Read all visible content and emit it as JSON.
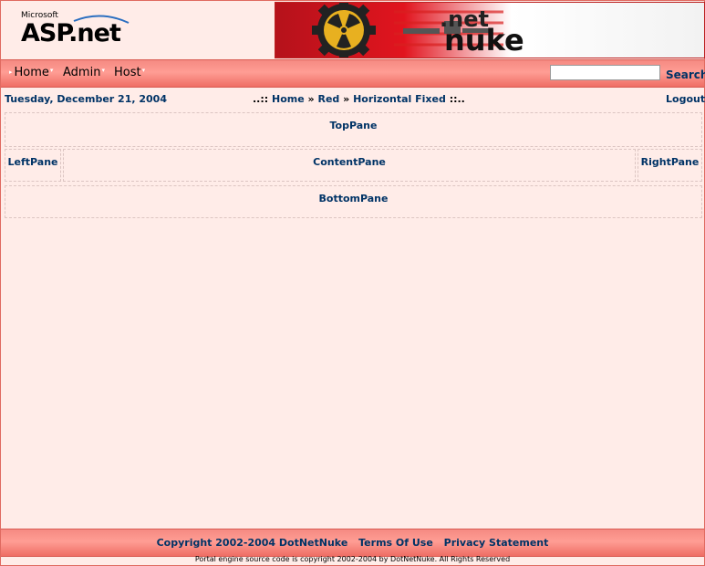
{
  "header": {
    "aspnet_logo_small": "Microsoft",
    "aspnet_logo_main": "ASP.net",
    "banner_dot": ".net",
    "banner_word": "nuke"
  },
  "menu": {
    "items": [
      {
        "label": "Home"
      },
      {
        "label": "Admin"
      },
      {
        "label": "Host"
      }
    ]
  },
  "search": {
    "value": "",
    "button_label": "Search"
  },
  "info": {
    "date": "Tuesday, December 21, 2004",
    "breadcrumb_prefix": "..::",
    "breadcrumb": [
      "Home",
      "Red",
      "Horizontal Fixed"
    ],
    "breadcrumb_sep": "»",
    "breadcrumb_suffix": "::..",
    "logout_label": "Logout"
  },
  "panes": {
    "top": "TopPane",
    "left": "LeftPane",
    "content": "ContentPane",
    "right": "RightPane",
    "bottom": "BottomPane"
  },
  "footer": {
    "copyright": "Copyright 2002-2004 DotNetNuke",
    "terms": "Terms Of Use",
    "privacy": "Privacy Statement",
    "portal_copy": "Portal engine source code is copyright 2002-2004 by DotNetNuke. All Rights Reserved"
  },
  "colors": {
    "menu_bar": "#ff9d94",
    "link_text": "#003366",
    "page_bg": "#ffece8"
  }
}
